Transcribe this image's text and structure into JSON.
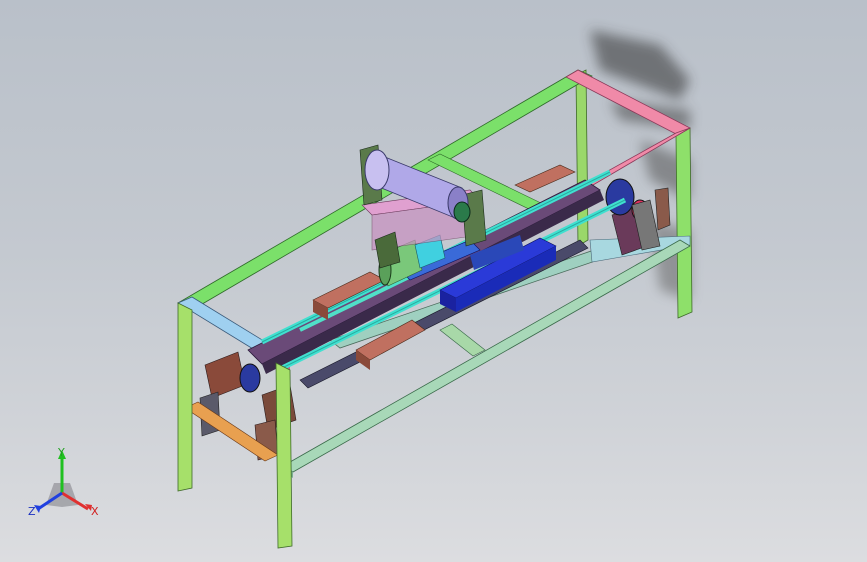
{
  "viewport": {
    "background_top": "#b9c0c9",
    "background_bottom": "#dcdde0"
  },
  "model": {
    "frame_colors": {
      "front": "#a6e06a",
      "top_left": "#7be06a",
      "top_right": "#f08aa8",
      "back_post": "#8ee06a",
      "bottom_rail": "#a8d8b8",
      "orange_rail": "#e8a050",
      "blue_rail": "#9fd0f0"
    },
    "part_colors": {
      "roll": "#b0a8e8",
      "slide_blue": "#1a2bd0",
      "rod_cyan": "#40e0d0",
      "plate_purple": "#8a3aa0",
      "bracket_brown": "#8a4a3a",
      "tan_block": "#c07060"
    }
  },
  "triad": {
    "x_label": "X",
    "y_label": "Y",
    "z_label": "Z",
    "x_color": "#e03030",
    "y_color": "#20c020",
    "z_color": "#2040e0"
  }
}
